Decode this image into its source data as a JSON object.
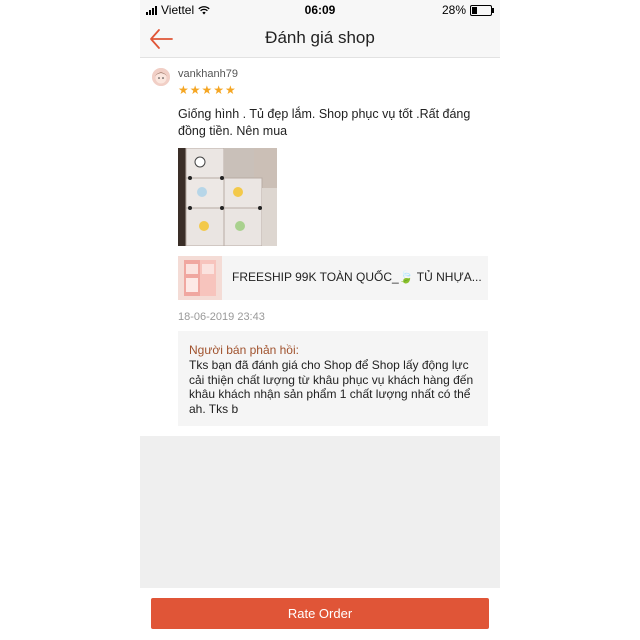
{
  "status_bar": {
    "carrier": "Viettel",
    "time": "06:09",
    "battery": "28%",
    "battery_level": 0.28
  },
  "header": {
    "title": "Đánh giá shop",
    "back_icon": "arrow-left-icon"
  },
  "review": {
    "username": "vankhanh79",
    "rating": 5,
    "stars": "★★★★★",
    "comment": "Giống hình . Tủ đẹp lắm. Shop phục vụ tốt .Rất đáng đồng tiền. Nên mua",
    "product_name": "FREESHIP 99K TOÀN QUỐC_🍃 TỦ NHỰA...",
    "date": "18-06-2019 23:43",
    "seller_reply": {
      "label": "Người bán phản hồi:",
      "text": "Tks bạn đã đánh giá cho Shop để Shop lấy động lực cải thiện chất lượng từ khâu phục vụ khách hàng đến khâu khách nhận sản phẩm 1 chất lượng nhất có thể ah. Tks b"
    }
  },
  "actions": {
    "rate_order_label": "Rate Order"
  },
  "colors": {
    "accent": "#e05537",
    "star": "#f5a623",
    "reply_label": "#a0522d"
  }
}
